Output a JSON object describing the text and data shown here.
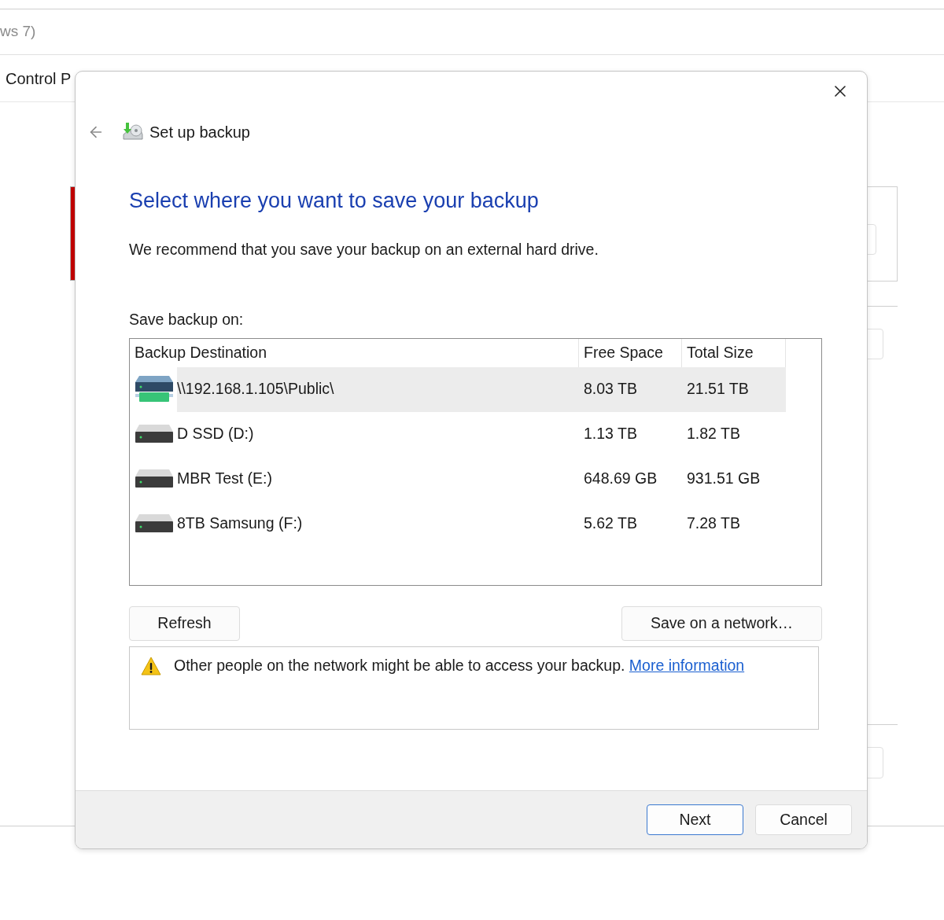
{
  "background_window": {
    "title": "ws 7)",
    "breadcrumb": "Control P"
  },
  "dialog": {
    "title": "Set up backup",
    "heading": "Select where you want to save your backup",
    "description": "We recommend that you save your backup on an external hard drive.",
    "list_label": "Save backup on:",
    "columns": [
      "Backup Destination",
      "Free Space",
      "Total Size"
    ],
    "rows": [
      {
        "kind": "network",
        "name": "\\\\192.168.1.105\\Public\\",
        "free": "8.03 TB",
        "total": "21.51 TB",
        "selected": true
      },
      {
        "kind": "disk",
        "name": "D SSD (D:)",
        "free": "1.13 TB",
        "total": "1.82 TB",
        "selected": false
      },
      {
        "kind": "disk",
        "name": "MBR Test (E:)",
        "free": "648.69 GB",
        "total": "931.51 GB",
        "selected": false
      },
      {
        "kind": "disk",
        "name": "8TB Samsung (F:)",
        "free": "5.62 TB",
        "total": "7.28 TB",
        "selected": false
      }
    ],
    "buttons": [
      {
        "label": "Refresh"
      },
      {
        "label": "Save on a network…"
      }
    ],
    "warning": {
      "text": "Other people on the network might be able to access your backup.",
      "link": "More information"
    },
    "footer_buttons": [
      {
        "label": "Next",
        "default": true
      },
      {
        "label": "Cancel",
        "default": false
      }
    ]
  }
}
